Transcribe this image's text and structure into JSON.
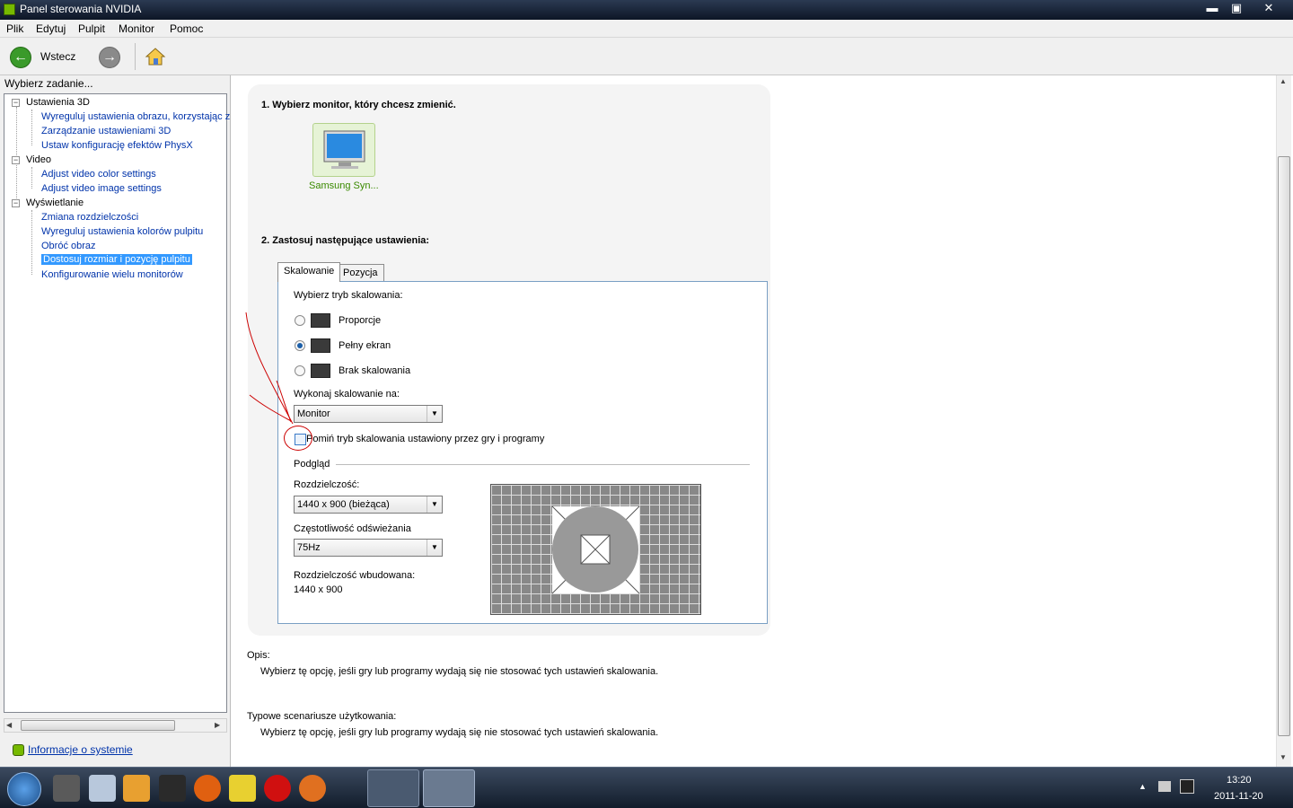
{
  "window": {
    "title": "Panel sterowania NVIDIA",
    "min": "▬",
    "max": "▣",
    "close": "✕"
  },
  "menu": [
    "Plik",
    "Edytuj",
    "Pulpit",
    "Monitor",
    "Pomoc"
  ],
  "toolbar": {
    "back_label": "Wstecz"
  },
  "left": {
    "task_label": "Wybierz zadanie...",
    "tree": [
      {
        "label": "Ustawienia 3D",
        "children": [
          "Wyreguluj ustawienia obrazu, korzystając z",
          "Zarządzanie ustawieniami 3D",
          "Ustaw konfigurację efektów PhysX"
        ]
      },
      {
        "label": "Video",
        "children": [
          "Adjust video color settings",
          "Adjust video image settings"
        ]
      },
      {
        "label": "Wyświetlanie",
        "children": [
          "Zmiana rozdzielczości",
          "Wyreguluj ustawienia kolorów pulpitu",
          "Obróć obraz",
          "Dostosuj rozmiar i pozycję pulpitu",
          "Konfigurowanie wielu monitorów"
        ]
      }
    ],
    "selected": "Dostosuj rozmiar i pozycję pulpitu",
    "system_info": "Informacje o systemie"
  },
  "main": {
    "step1": "1. Wybierz monitor, który chcesz zmienić.",
    "monitor_label": "Samsung Syn...",
    "step2": "2. Zastosuj następujące ustawienia:",
    "tabs": [
      "Skalowanie",
      "Pozycja"
    ],
    "scaling_mode_label": "Wybierz tryb skalowania:",
    "modes": [
      "Proporcje",
      "Pełny ekran",
      "Brak skalowania"
    ],
    "selected_mode": "Pełny ekran",
    "perform_on_label": "Wykonaj skalowanie na:",
    "perform_on_value": "Monitor",
    "override_label": "Pomiń tryb skalowania ustawiony przez gry i programy",
    "override_checked": false,
    "preview_label": "Podgląd",
    "resolution_label": "Rozdzielczość:",
    "resolution_value": "1440 x 900 (bieżąca)",
    "refresh_label": "Częstotliwość odświeżania",
    "refresh_value": "75Hz",
    "native_label": "Rozdzielczość wbudowana:",
    "native_value": "1440 x 900",
    "desc_title": "Opis:",
    "desc_text": "Wybierz tę opcję, jeśli gry lub programy wydają się nie stosować tych ustawień skalowania.",
    "scen_title": "Typowe scenariusze użytkowania:",
    "scen_text": "Wybierz tę opcję, jeśli gry lub programy wydają się nie stosować tych ustawień skalowania."
  },
  "taskbar": {
    "time": "13:20",
    "date": "2011-11-20"
  },
  "colors": {
    "accent": "#76b900",
    "selection": "#3399ff",
    "link": "#0033aa",
    "annotation": "#cc0000"
  }
}
